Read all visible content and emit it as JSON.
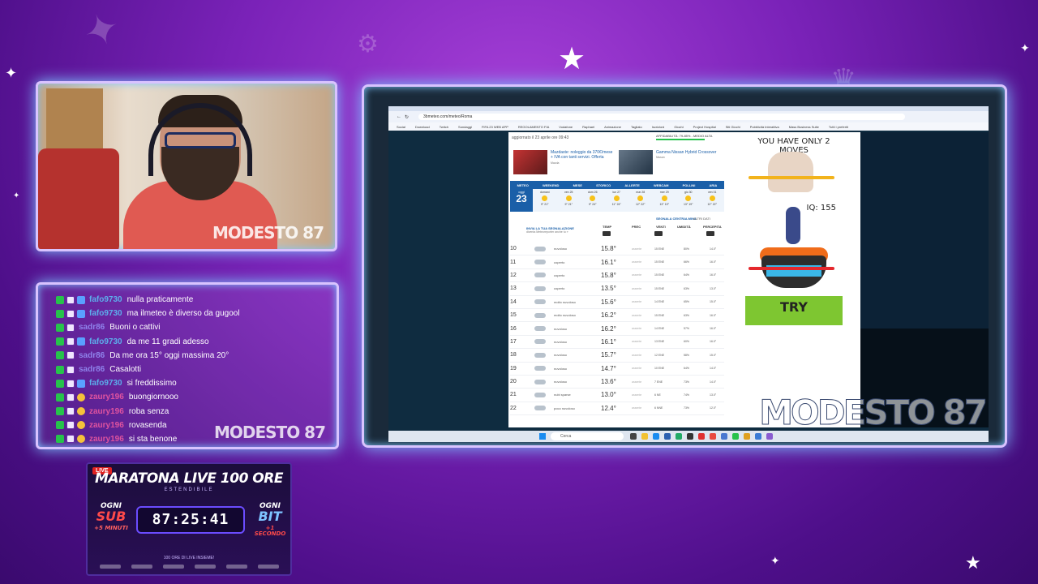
{
  "webcam": {
    "logo": "MODESTO 87"
  },
  "chat": {
    "messages": [
      {
        "user": "fafo9730",
        "text": "nulla praticamente",
        "color": "#5ad0ff",
        "badges": [
          "green",
          "sub",
          "blue"
        ]
      },
      {
        "user": "fafo9730",
        "text": "ma ilmeteo è diverso da gugool",
        "color": "#5ad0ff",
        "badges": [
          "green",
          "sub",
          "blue"
        ]
      },
      {
        "user": "sadr86",
        "text": "Buoni o cattivi",
        "color": "#9a9aff",
        "badges": [
          "green",
          "sub"
        ]
      },
      {
        "user": "fafo9730",
        "text": "da me 11 gradi adesso",
        "color": "#5ad0ff",
        "badges": [
          "green",
          "sub",
          "blue"
        ]
      },
      {
        "user": "sadr86",
        "text": "Da me ora 15° oggi massima 20°",
        "color": "#9a9aff",
        "badges": [
          "green",
          "sub"
        ]
      },
      {
        "user": "sadr86",
        "text": "Casalotti",
        "color": "#9a9aff",
        "badges": [
          "green",
          "sub"
        ]
      },
      {
        "user": "fafo9730",
        "text": "si freddissimo",
        "color": "#5ad0ff",
        "badges": [
          "green",
          "sub",
          "blue"
        ]
      },
      {
        "user": "zaury196",
        "text": "buongiornooo",
        "color": "#ff5fa2",
        "badges": [
          "green",
          "sub",
          "crown"
        ]
      },
      {
        "user": "zaury196",
        "text": "roba senza",
        "color": "#ff5fa2",
        "badges": [
          "green",
          "sub",
          "crown"
        ]
      },
      {
        "user": "zaury196",
        "text": "rovasenda",
        "color": "#ff5fa2",
        "badges": [
          "green",
          "sub",
          "crown"
        ]
      },
      {
        "user": "zaury196",
        "text": "si sta benone",
        "color": "#ff5fa2",
        "badges": [
          "green",
          "sub",
          "crown"
        ]
      }
    ],
    "logo": "MODESTO 87"
  },
  "marathon": {
    "live": "LIVE",
    "title": "MARATONA LIVE 100 ORE",
    "subtitle": "ESTENDIBILE",
    "sub_side": {
      "line1": "OGNI",
      "line2": "SUB",
      "line3": "+5 MINUTI"
    },
    "bit_side": {
      "line1": "OGNI",
      "line2": "BIT",
      "line3": "+1 SECONDO"
    },
    "timer": "87:25:41",
    "footer": "100 ORE DI LIVE INSIEME!"
  },
  "browser": {
    "url": "3bmeteo.com/meteo/Roma",
    "bookmarks": [
      "Social",
      "Download",
      "Twitch",
      "Sondaggi",
      "FIFA 23 WEB APP",
      "REGOLAMENTO FIA",
      "Vodafone",
      "Raphael",
      "Animazione",
      "Tagliato",
      "Iscrizioni",
      "Giochi",
      "Project Hospital",
      "Siti Giochi",
      "Pubblicità Interattiva",
      "Mass Business Suite",
      "Tutti i preferiti"
    ]
  },
  "weather": {
    "updated": "aggiornato il 23 aprile ore 09:43",
    "affidability": "AFFIDABILITÀ: 79-85% - MEDIO ALTA",
    "ads": [
      {
        "title": "Mazdaste: noleggio da 370€/mese + IVA con tanti servizi. Offerta",
        "source": "Mazda"
      },
      {
        "title": "Gamma Nissan Hybrid Crossover",
        "source": "Nissan"
      }
    ],
    "nav": [
      "METEO",
      "WEEKEND",
      "MESE",
      "STORICO",
      "ALLERTE",
      "WEBCAM",
      "POLLINI",
      "ARIA"
    ],
    "today": {
      "label": "oggi",
      "num": "23"
    },
    "days": [
      {
        "name": "domani",
        "temps": "9° 21°"
      },
      {
        "name": "ven 25",
        "temps": "9° 21°"
      },
      {
        "name": "dom 26",
        "temps": "9° 24°"
      },
      {
        "name": "lun 27",
        "temps": "11° 24°"
      },
      {
        "name": "mar 28",
        "temps": "12° 22°"
      },
      {
        "name": "mer 29",
        "temps": "13° 19°"
      },
      {
        "name": "gio 30",
        "temps": "13° 19°"
      },
      {
        "name": "ven 01",
        "temps": "12° 22°"
      }
    ],
    "segnala": "SEGNALA CENTRALMINA",
    "altri": "ALTRI DATI",
    "invia": "INVIA LA TUA SEGNALAZIONE",
    "invia_sub": "diventa Meteoreporter anche tu »",
    "headers": {
      "temp": "TEMP",
      "prec": "PREC",
      "venti": "VENTI",
      "umid": "UMIDITÀ",
      "perc": "PERCEPITA"
    },
    "rows": [
      {
        "hour": "10",
        "desc": "nuvoloso",
        "temp": "15.8°",
        "prec": "assente",
        "wind": "15 ENE",
        "hum": "80%",
        "perc": "14.0°"
      },
      {
        "hour": "11",
        "desc": "coperto",
        "temp": "16.1°",
        "prec": "assente",
        "wind": "15 ENE",
        "hum": "66%",
        "perc": "16.0°"
      },
      {
        "hour": "12",
        "desc": "coperto",
        "temp": "15.8°",
        "prec": "assente",
        "wind": "15 ENE",
        "hum": "64%",
        "perc": "16.0°"
      },
      {
        "hour": "13",
        "desc": "coperto",
        "temp": "13.5°",
        "prec": "assente",
        "wind": "15 ENE",
        "hum": "63%",
        "perc": "13.0°"
      },
      {
        "hour": "14",
        "desc": "molto nuvoloso",
        "temp": "15.6°",
        "prec": "assente",
        "wind": "14 ENE",
        "hum": "65%",
        "perc": "15.0°"
      },
      {
        "hour": "15",
        "desc": "molto nuvoloso",
        "temp": "16.2°",
        "prec": "assente",
        "wind": "15 ENE",
        "hum": "63%",
        "perc": "16.0°"
      },
      {
        "hour": "16",
        "desc": "nuvoloso",
        "temp": "16.2°",
        "prec": "assente",
        "wind": "14 ENE",
        "hum": "57%",
        "perc": "16.0°"
      },
      {
        "hour": "17",
        "desc": "nuvoloso",
        "temp": "16.1°",
        "prec": "assente",
        "wind": "13 ENE",
        "hum": "60%",
        "perc": "16.0°"
      },
      {
        "hour": "18",
        "desc": "nuvoloso",
        "temp": "15.7°",
        "prec": "assente",
        "wind": "12 ENE",
        "hum": "58%",
        "perc": "15.0°"
      },
      {
        "hour": "19",
        "desc": "nuvoloso",
        "temp": "14.7°",
        "prec": "assente",
        "wind": "10 ENE",
        "hum": "64%",
        "perc": "14.0°"
      },
      {
        "hour": "20",
        "desc": "nuvoloso",
        "temp": "13.6°",
        "prec": "assente",
        "wind": "7 ENE",
        "hum": "73%",
        "perc": "14.0°"
      },
      {
        "hour": "21",
        "desc": "nubi sparse",
        "temp": "13.0°",
        "prec": "assente",
        "wind": "6 NE",
        "hum": "74%",
        "perc": "13.0°"
      },
      {
        "hour": "22",
        "desc": "poco nuvoloso",
        "temp": "12.4°",
        "prec": "assente",
        "wind": "6 NNE",
        "hum": "73%",
        "perc": "12.0°"
      }
    ]
  },
  "game_ad": {
    "title": "YOU HAVE ONLY 2 MOVES",
    "iq": "IQ: 155",
    "cta": "TRY"
  },
  "screen": {
    "logo": "MODESTO 87"
  },
  "taskbar": {
    "search": "Cerca"
  },
  "colors": {
    "frame_glow": "#7cc6ff",
    "frame_border": "#d9c3ff",
    "bg": "#7a22b8",
    "meteo_blue": "#1a5fa8"
  }
}
